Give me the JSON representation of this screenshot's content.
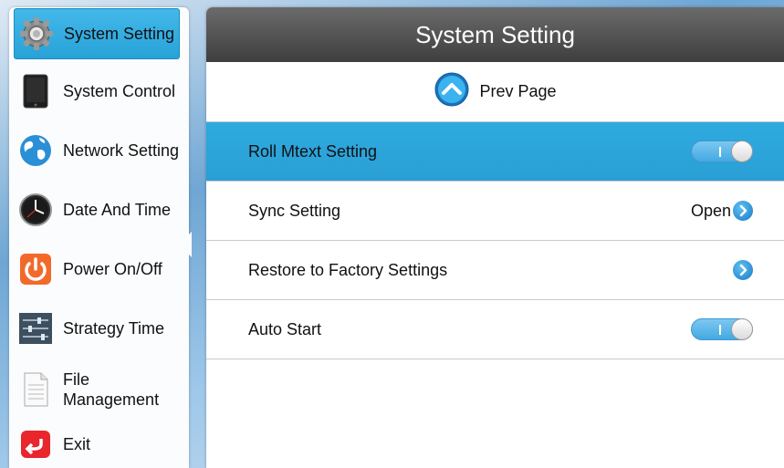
{
  "sidebar": {
    "items": [
      {
        "label": "System Setting",
        "icon": "gear-icon",
        "active": true
      },
      {
        "label": "System Control",
        "icon": "tablet-icon"
      },
      {
        "label": "Network Setting",
        "icon": "globe-icon"
      },
      {
        "label": "Date And Time",
        "icon": "clock-icon"
      },
      {
        "label": "Power On/Off",
        "icon": "power-icon"
      },
      {
        "label": "Strategy Time",
        "icon": "sliders-icon"
      },
      {
        "label": "File Management",
        "label_line1": "File",
        "label_line2": "Management",
        "icon": "document-icon"
      },
      {
        "label": "Exit",
        "icon": "exit-icon"
      }
    ]
  },
  "main": {
    "title": "System Setting",
    "prev_page_label": "Prev Page",
    "rows": [
      {
        "label": "Roll Mtext Setting",
        "control": "toggle",
        "active": true
      },
      {
        "label": "Sync Setting",
        "value": "Open",
        "control": "arrow"
      },
      {
        "label": "Restore to Factory Settings",
        "control": "arrow"
      },
      {
        "label": "Auto Start",
        "control": "toggle"
      }
    ]
  },
  "colors": {
    "accent": "#2aa6dc",
    "header": "#4a4a4a"
  }
}
